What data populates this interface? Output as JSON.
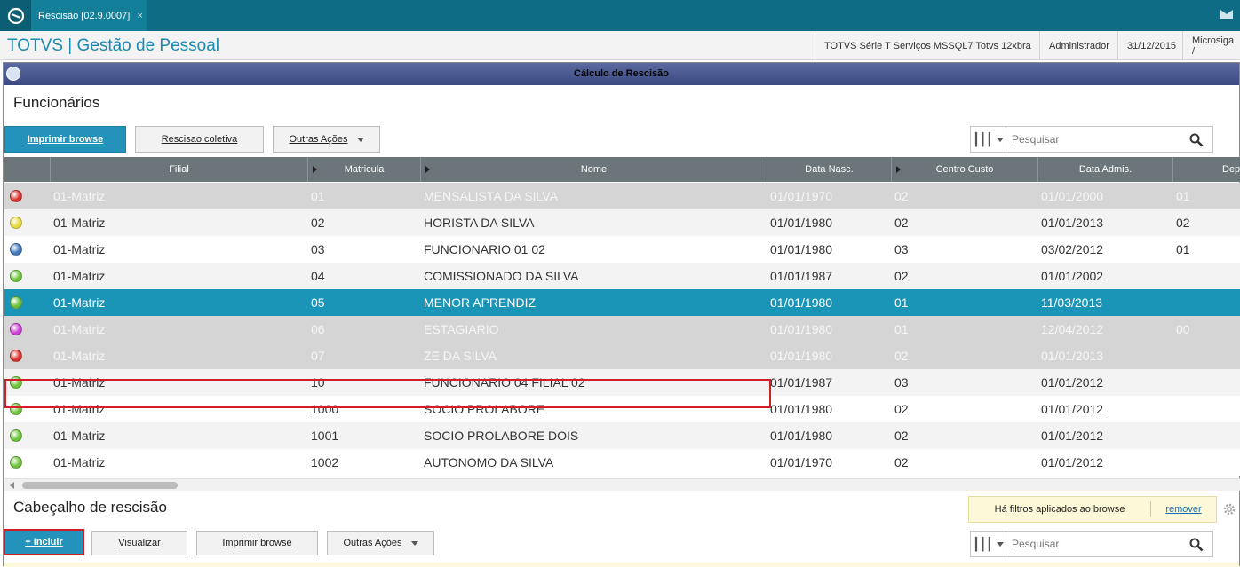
{
  "tab": {
    "label": "Rescisão [02.9.0007]",
    "close": "×"
  },
  "app": {
    "title": "TOTVS | Gestão de Pessoal"
  },
  "header": {
    "environment": "TOTVS Série T Serviços MSSQL7 Totvs 12xbra",
    "user": "Administrador",
    "date": "31/12/2015",
    "company": "Microsiga /"
  },
  "window": {
    "title": "Cálculo de Rescisão"
  },
  "funcionarios": {
    "title": "Funcionários",
    "buttons": {
      "print": "Imprimir browse",
      "collective": "Rescisao coletiva",
      "more": "Outras Ações"
    },
    "search": {
      "placeholder": "Pesquisar"
    },
    "columns": [
      "Filial",
      "Matricula",
      "Nome",
      "Data Nasc.",
      "Centro Custo",
      "Data Admis.",
      "Dep. I.R."
    ],
    "rows": [
      {
        "status": "#d8322f",
        "filial": "01-Matriz",
        "matricula": "01",
        "nome": "MENSALISTA DA SILVA",
        "nasc": "01/01/1970",
        "cc": "02",
        "admis": "01/01/2000",
        "dep": "01",
        "style": "grey"
      },
      {
        "status": "#e6d93a",
        "filial": "01-Matriz",
        "matricula": "02",
        "nome": "HORISTA DA SILVA",
        "nasc": "01/01/1980",
        "cc": "02",
        "admis": "01/01/2013",
        "dep": "02",
        "style": "even"
      },
      {
        "status": "#3f76b8",
        "filial": "01-Matriz",
        "matricula": "03",
        "nome": "FUNCIONARIO 01 02",
        "nasc": "01/01/1980",
        "cc": "03",
        "admis": "03/02/2012",
        "dep": "01",
        "style": "odd"
      },
      {
        "status": "#6cc33a",
        "filial": "01-Matriz",
        "matricula": "04",
        "nome": "COMISSIONADO DA SILVA",
        "nasc": "01/01/1987",
        "cc": "02",
        "admis": "01/01/2002",
        "dep": "",
        "style": "even"
      },
      {
        "status": "#6cc33a",
        "filial": "01-Matriz",
        "matricula": "05",
        "nome": "MENOR APRENDIZ",
        "nasc": "01/01/1980",
        "cc": "01",
        "admis": "11/03/2013",
        "dep": "",
        "style": "selected"
      },
      {
        "status": "#c93fd1",
        "filial": "01-Matriz",
        "matricula": "06",
        "nome": "ESTAGIARIO",
        "nasc": "01/01/1980",
        "cc": "01",
        "admis": "12/04/2012",
        "dep": "00",
        "style": "grey"
      },
      {
        "status": "#d8322f",
        "filial": "01-Matriz",
        "matricula": "07",
        "nome": "ZE DA SILVA",
        "nasc": "01/01/1980",
        "cc": "02",
        "admis": "01/01/2013",
        "dep": "",
        "style": "grey"
      },
      {
        "status": "#6cc33a",
        "filial": "01-Matriz",
        "matricula": "10",
        "nome": "FUNCIONARIO 04 FILIAL 02",
        "nasc": "01/01/1987",
        "cc": "03",
        "admis": "01/01/2012",
        "dep": "",
        "style": "even"
      },
      {
        "status": "#6cc33a",
        "filial": "01-Matriz",
        "matricula": "1000",
        "nome": "SOCIO PROLABORE",
        "nasc": "01/01/1980",
        "cc": "02",
        "admis": "01/01/2012",
        "dep": "",
        "style": "odd"
      },
      {
        "status": "#6cc33a",
        "filial": "01-Matriz",
        "matricula": "1001",
        "nome": "SOCIO PROLABORE DOIS",
        "nasc": "01/01/1980",
        "cc": "02",
        "admis": "01/01/2012",
        "dep": "",
        "style": "even"
      },
      {
        "status": "#6cc33a",
        "filial": "01-Matriz",
        "matricula": "1002",
        "nome": "AUTONOMO DA SILVA",
        "nasc": "01/01/1970",
        "cc": "02",
        "admis": "01/01/2012",
        "dep": "",
        "style": "odd"
      }
    ]
  },
  "cabecalho": {
    "title": "Cabeçalho de rescisão",
    "filter_notice": "Há filtros aplicados ao browse",
    "filter_remove": "remover",
    "buttons": {
      "include": "+ Incluir",
      "view": "Visualizar",
      "print": "Imprimir browse",
      "more": "Outras Ações"
    },
    "search": {
      "placeholder": "Pesquisar"
    }
  }
}
